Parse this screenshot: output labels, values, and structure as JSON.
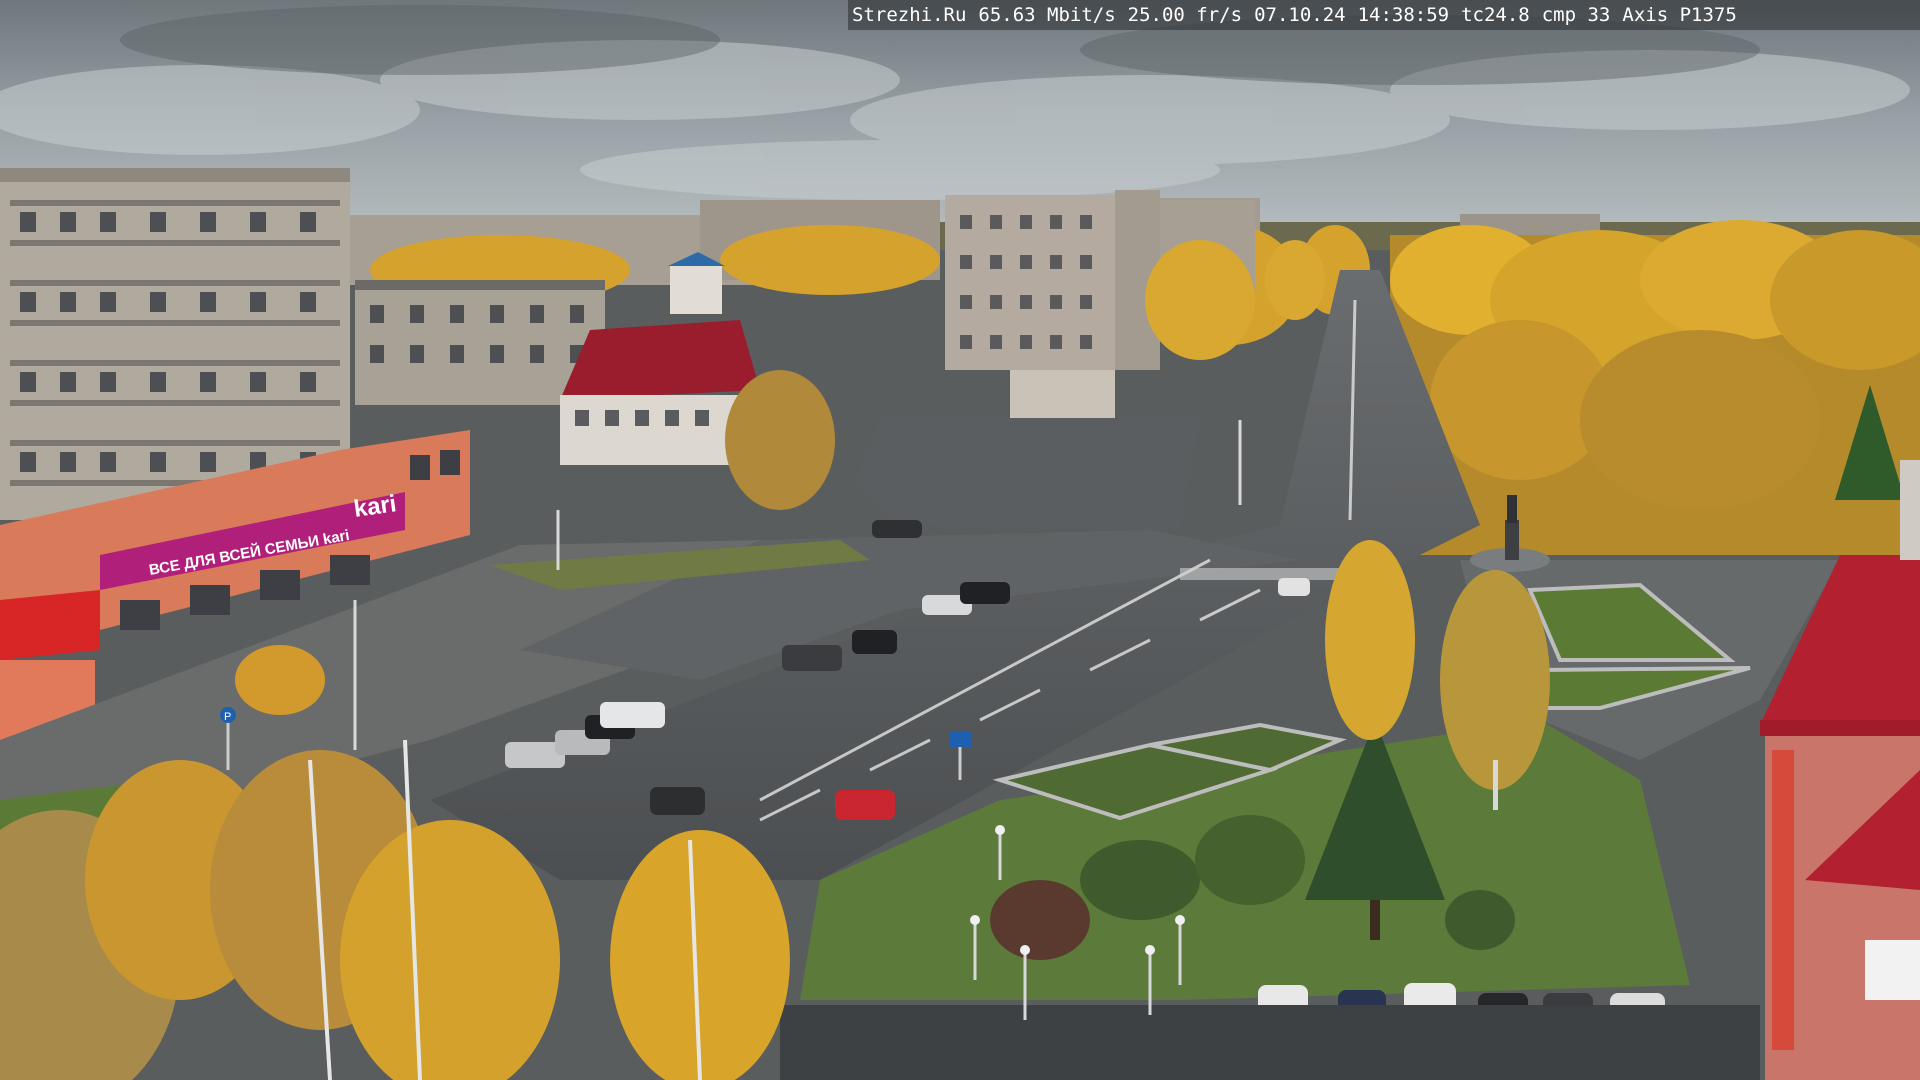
{
  "overlay": {
    "site": "Strezhi.Ru",
    "bitrate": "65.63 Mbit/s",
    "framerate": "25.00 fr/s",
    "date": "07.10.24",
    "time": "14:38:59",
    "tc": "tc24.8",
    "cmp": "cmp 33",
    "camera": "Axis P1375"
  },
  "scene": {
    "store_sign": "kari",
    "store_banner": "ВСЕ ДЛЯ ВСЕЙ СЕМЬИ kari",
    "road_sign": "P",
    "colors": {
      "sky": "#9aa3a8",
      "asphalt": "#55585a",
      "autumn_foliage": "#d9a72c",
      "grass": "#5c7a3a",
      "kari_magenta": "#b0207a",
      "roof_red": "#b32030"
    }
  }
}
